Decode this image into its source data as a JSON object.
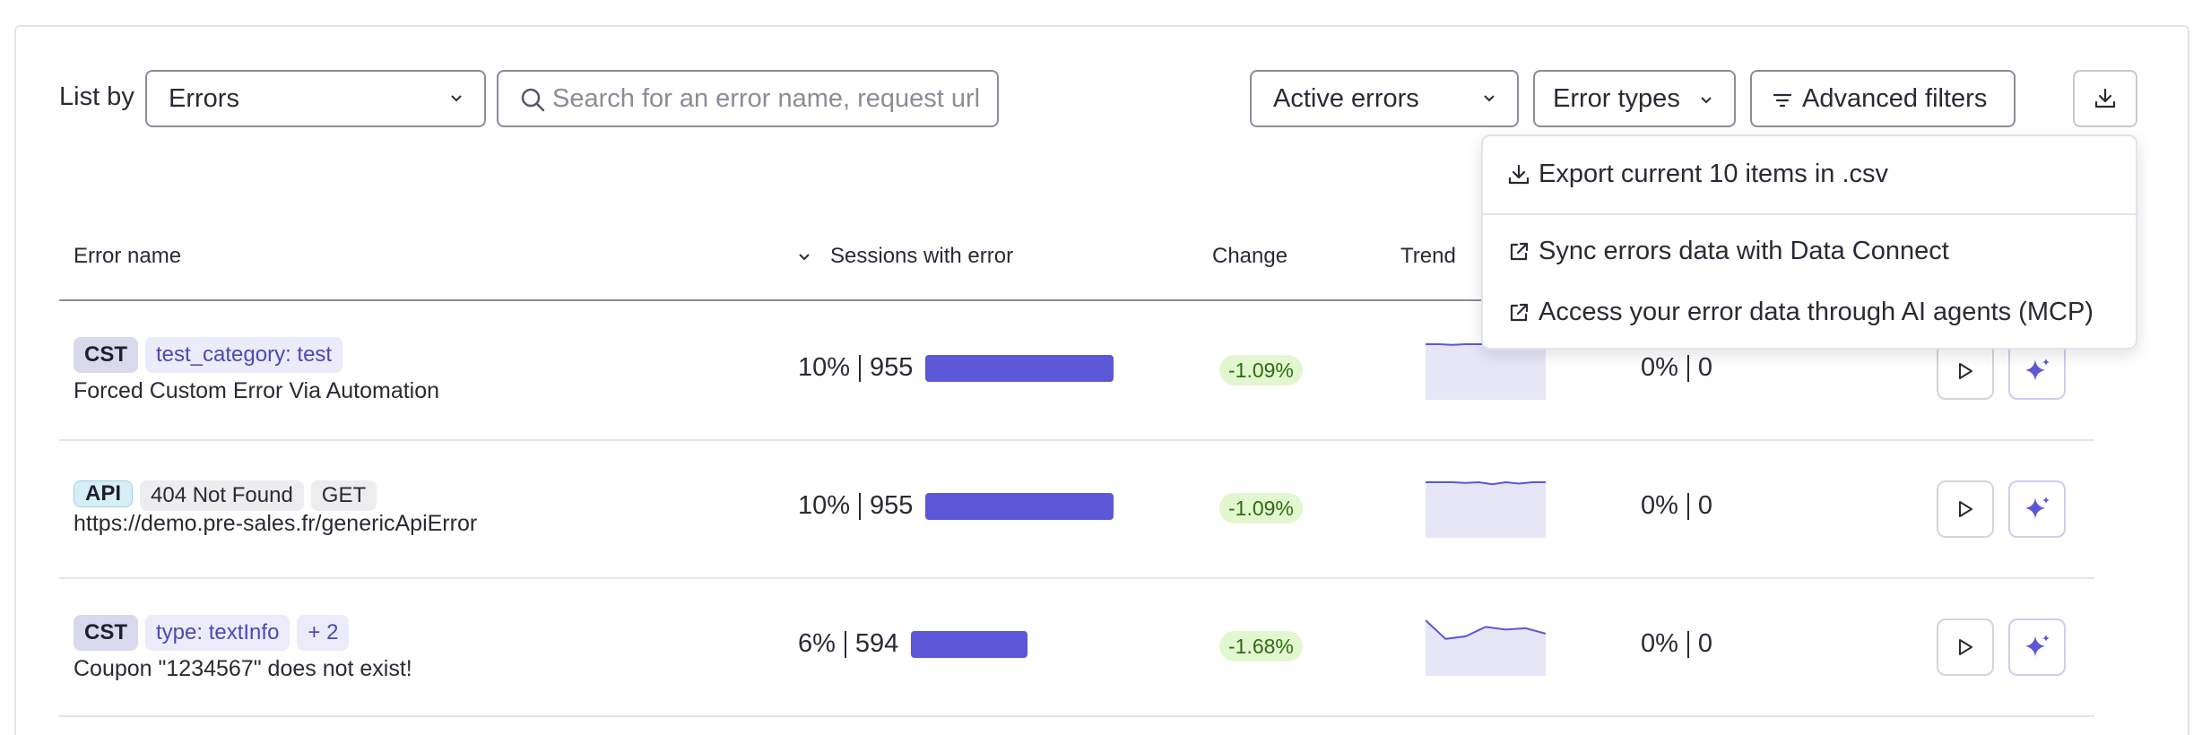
{
  "toolbar": {
    "list_by_label": "List by",
    "list_by_value": "Errors",
    "search_placeholder": "Search for an error name, request url",
    "status_filter": "Active errors",
    "error_types": "Error types",
    "advanced_filters": "Advanced filters"
  },
  "export_menu": {
    "items": [
      {
        "label": "Export current 10 items in .csv",
        "icon": "download-icon"
      },
      {
        "label": "Sync errors data with Data Connect",
        "icon": "external-link-icon"
      },
      {
        "label": "Access your error data through AI agents (MCP)",
        "icon": "external-link-icon"
      }
    ]
  },
  "table": {
    "columns": [
      "Error name",
      "Sessions with error",
      "Change",
      "Trend"
    ],
    "sort_column": "Sessions with error",
    "rows": [
      {
        "type": "CST",
        "tags": [
          "test_category: test"
        ],
        "name": "Forced Custom Error Via Automation",
        "sessions_pct": "10%",
        "sessions_count": "955",
        "bar_fraction": 1.0,
        "change": "-1.09%",
        "trend": [
          1,
          1,
          0.99,
          1,
          1,
          1,
          1,
          1,
          1,
          1
        ],
        "errors_pct": "0%",
        "errors_count": "0"
      },
      {
        "type": "API",
        "tags": [
          "404 Not Found",
          "GET"
        ],
        "name": "https://demo.pre-sales.fr/genericApiError",
        "sessions_pct": "10%",
        "sessions_count": "955",
        "bar_fraction": 1.0,
        "change": "-1.09%",
        "trend": [
          1,
          1,
          1,
          0.99,
          1,
          0.97,
          1,
          0.98,
          1,
          1
        ],
        "errors_pct": "0%",
        "errors_count": "0"
      },
      {
        "type": "CST",
        "tags": [
          "type: textInfo",
          "+ 2"
        ],
        "name": "Coupon \"1234567\" does not exist!",
        "sessions_pct": "6%",
        "sessions_count": "594",
        "bar_fraction": 0.62,
        "change": "-1.68%",
        "trend": [
          1,
          0.72,
          0.76,
          0.9,
          0.86,
          0.88,
          0.8
        ],
        "errors_pct": "0%",
        "errors_count": "0"
      }
    ]
  },
  "colors": {
    "accent": "#5b57d6",
    "trend_fill": "#e6e6f6",
    "change_bg": "#e2f7cf",
    "change_text": "#2e6b12"
  }
}
